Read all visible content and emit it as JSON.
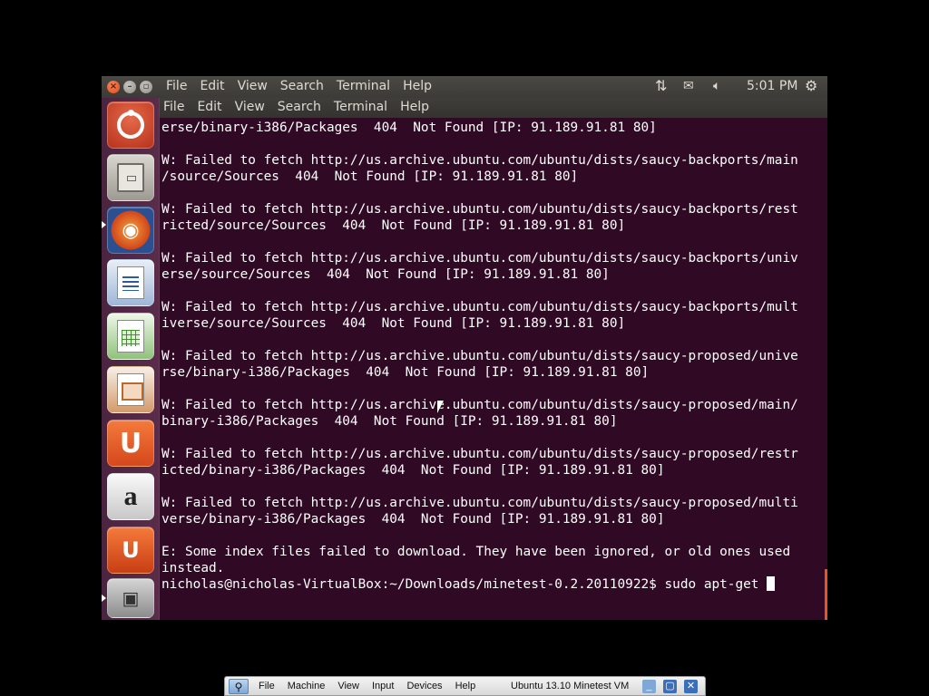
{
  "top_panel": {
    "menu": [
      "File",
      "Edit",
      "View",
      "Search",
      "Terminal",
      "Help"
    ],
    "clock": "5:01 PM",
    "icons": [
      "network-arrows-icon",
      "mail-icon",
      "volume-icon",
      "gear-icon"
    ]
  },
  "terminal_menu": [
    "File",
    "Edit",
    "View",
    "Search",
    "Terminal",
    "Help"
  ],
  "launcher": [
    {
      "name": "dash-home",
      "icon": "ubuntu-logo-icon"
    },
    {
      "name": "files",
      "icon": "file-cabinet-icon"
    },
    {
      "name": "firefox",
      "icon": "firefox-icon"
    },
    {
      "name": "libreoffice-writer",
      "icon": "writer-document-icon"
    },
    {
      "name": "libreoffice-calc",
      "icon": "calc-spreadsheet-icon"
    },
    {
      "name": "libreoffice-impress",
      "icon": "impress-presentation-icon"
    },
    {
      "name": "ubuntu-one",
      "icon": "ubuntu-one-icon"
    },
    {
      "name": "amazon",
      "icon": "amazon-icon"
    },
    {
      "name": "ubuntu-software-center",
      "icon": "software-center-icon"
    },
    {
      "name": "virtualbox",
      "icon": "virtualbox-icon"
    }
  ],
  "terminal": {
    "lines": [
      "erse/binary-i386/Packages  404  Not Found [IP: 91.189.91.81 80]",
      "",
      "W: Failed to fetch http://us.archive.ubuntu.com/ubuntu/dists/saucy-backports/main",
      "/source/Sources  404  Not Found [IP: 91.189.91.81 80]",
      "",
      "W: Failed to fetch http://us.archive.ubuntu.com/ubuntu/dists/saucy-backports/rest",
      "ricted/source/Sources  404  Not Found [IP: 91.189.91.81 80]",
      "",
      "W: Failed to fetch http://us.archive.ubuntu.com/ubuntu/dists/saucy-backports/univ",
      "erse/source/Sources  404  Not Found [IP: 91.189.91.81 80]",
      "",
      "W: Failed to fetch http://us.archive.ubuntu.com/ubuntu/dists/saucy-backports/mult",
      "iverse/source/Sources  404  Not Found [IP: 91.189.91.81 80]",
      "",
      "W: Failed to fetch http://us.archive.ubuntu.com/ubuntu/dists/saucy-proposed/unive",
      "rse/binary-i386/Packages  404  Not Found [IP: 91.189.91.81 80]",
      "",
      "W: Failed to fetch http://us.archive.ubuntu.com/ubuntu/dists/saucy-proposed/main/",
      "binary-i386/Packages  404  Not Found [IP: 91.189.91.81 80]",
      "",
      "W: Failed to fetch http://us.archive.ubuntu.com/ubuntu/dists/saucy-proposed/restr",
      "icted/binary-i386/Packages  404  Not Found [IP: 91.189.91.81 80]",
      "",
      "W: Failed to fetch http://us.archive.ubuntu.com/ubuntu/dists/saucy-proposed/multi",
      "verse/binary-i386/Packages  404  Not Found [IP: 91.189.91.81 80]",
      "",
      "E: Some index files failed to download. They have been ignored, or old ones used",
      "instead."
    ],
    "prompt": "nicholas@nicholas-VirtualBox:~/Downloads/minetest-0.2.20110922$ ",
    "command": "sudo apt-get "
  },
  "vbox_bar": {
    "menu": [
      "File",
      "Machine",
      "View",
      "Input",
      "Devices",
      "Help"
    ],
    "title": "Ubuntu 13.10 Minetest VM"
  },
  "colors": {
    "terminal_bg": "#300a24",
    "panel_bg": "#3c3b37",
    "accent": "#e95420"
  }
}
